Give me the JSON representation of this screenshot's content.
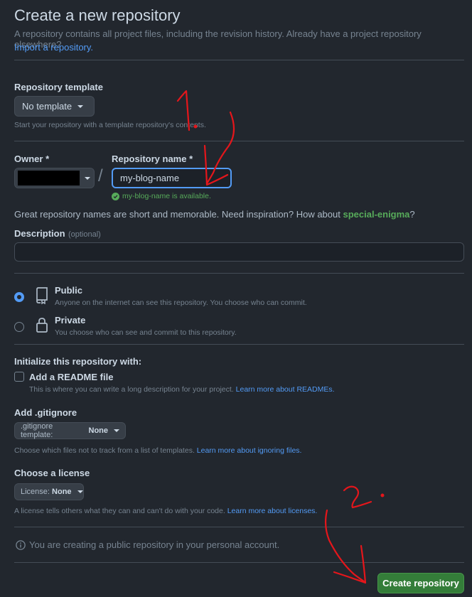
{
  "header": {
    "title": "Create a new repository",
    "description": "A repository contains all project files, including the revision history. Already have a project repository elsewhere?",
    "import_link": "Import a repository."
  },
  "template": {
    "label": "Repository template",
    "button": "No template",
    "note": "Start your repository with a template repository's contents."
  },
  "owner": {
    "label": "Owner *",
    "value_redacted": true
  },
  "slash": "/",
  "repo_name": {
    "label": "Repository name *",
    "value": "my-blog-name",
    "availability": "my-blog-name is available."
  },
  "inspiration": {
    "text": "Great repository names are short and memorable. Need inspiration? How about",
    "suggestion": "special-enigma",
    "end": "?"
  },
  "description_field": {
    "label": "Description",
    "optional": "(optional)",
    "value": ""
  },
  "visibility": {
    "selected": "public",
    "public": {
      "label": "Public",
      "desc": "Anyone on the internet can see this repository. You choose who can commit."
    },
    "private": {
      "label": "Private",
      "desc": "You choose who can see and commit to this repository."
    }
  },
  "init": {
    "heading": "Initialize this repository with:",
    "readme_label": "Add a README file",
    "readme_checked": false,
    "readme_desc": "This is where you can write a long description for your project.",
    "readme_link": "Learn more about READMEs."
  },
  "gitignore": {
    "label": "Add .gitignore",
    "button_prefix": ".gitignore template:",
    "button_value": "None",
    "desc": "Choose which files not to track from a list of templates.",
    "link": "Learn more about ignoring files."
  },
  "license": {
    "label": "Choose a license",
    "button_prefix": "License:",
    "button_value": "None",
    "desc": "A license tells others what they can and can't do with your code.",
    "link": "Learn more about licenses."
  },
  "public_notice": "You are creating a public repository in your personal account.",
  "submit": {
    "label": "Create repository"
  },
  "annotations": {
    "color": "#e5161b",
    "step1": "1.",
    "step2": "2."
  },
  "colors": {
    "bg": "#22272e",
    "accent": "#539bf5",
    "success": "#57ab5a",
    "button_green": "#347d39"
  }
}
